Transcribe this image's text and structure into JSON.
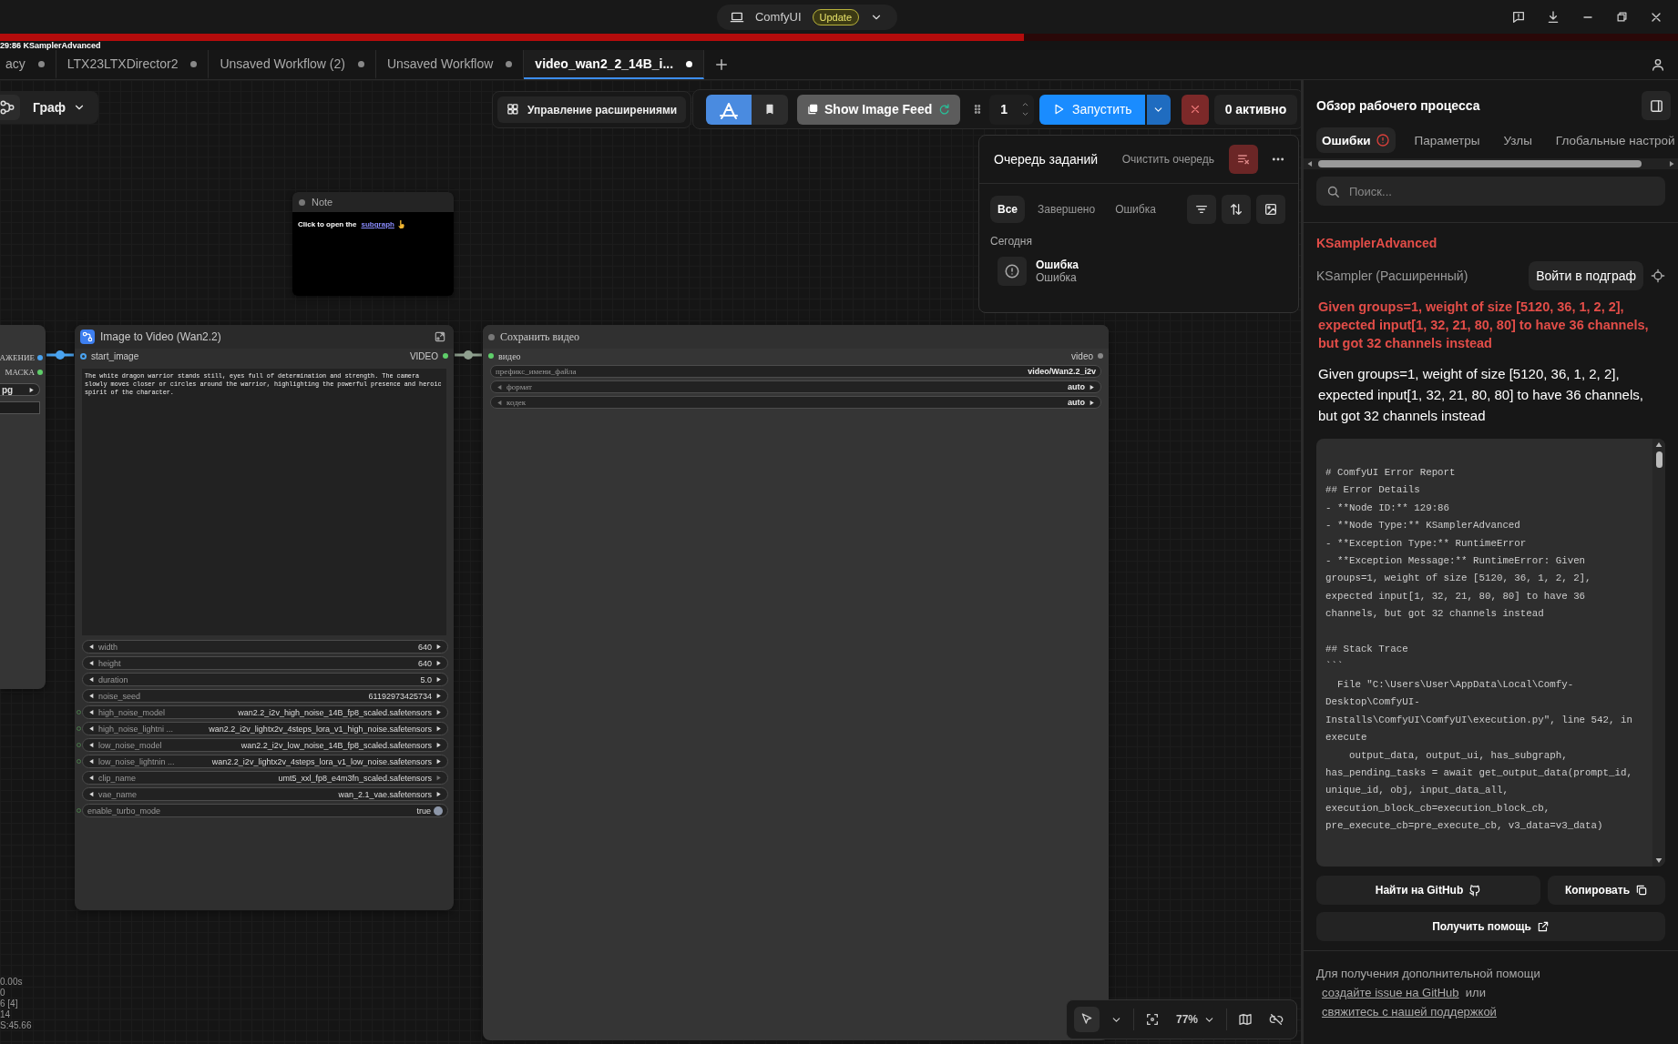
{
  "title_bar": {
    "app_name": "ComfyUI",
    "badge": "Update"
  },
  "progress": {
    "level": 0.61,
    "label": "29:86 KSamplerAdvanced"
  },
  "tabs": [
    {
      "label": "acy",
      "selected": false,
      "modified": true
    },
    {
      "label": "LTX23LTXDirector2",
      "selected": false,
      "modified": true
    },
    {
      "label": "Unsaved Workflow (2)",
      "selected": false,
      "modified": true
    },
    {
      "label": "Unsaved Workflow",
      "selected": false,
      "modified": true
    },
    {
      "label": "video_wan2_2_14B_i...",
      "selected": true,
      "modified": true
    }
  ],
  "canvas_toolbar": {
    "view_menu": "Граф",
    "extensions_button": "Управление расширениями",
    "image_feed_button": "Show Image Feed",
    "batch_count": "1",
    "run_button": "Запустить",
    "active_count": "0 активно"
  },
  "queue": {
    "title": "Очередь заданий",
    "clear_button": "Очистить очередь",
    "filters": [
      {
        "label": "Все",
        "selected": true
      },
      {
        "label": "Завершено",
        "selected": false
      },
      {
        "label": "Ошибка",
        "selected": false
      }
    ],
    "group": "Сегодня",
    "jobs": [
      {
        "title": "Ошибка",
        "status": "Ошибка"
      }
    ]
  },
  "note_node": {
    "title": "Note",
    "text": "Click to open the",
    "link": "subgraph"
  },
  "left_node": {
    "outputs": [
      {
        "label": "АЖЕНИЕ",
        "color": "#4aa3ef"
      },
      {
        "label": "МАСКА",
        "color": "#5fcf6a"
      }
    ],
    "combo_value": "pg"
  },
  "i2v_node": {
    "title": "Image to Video (Wan2.2)",
    "input": "start_image",
    "output": "VIDEO",
    "prompt": "The white dragon warrior stands still, eyes full of determination and strength. The camera slowly moves closer or circles around the warrior, highlighting the powerful presence and heroic spirit of the character.",
    "widgets": [
      {
        "kind": "number",
        "name": "width",
        "value": "640",
        "socket": false
      },
      {
        "kind": "number",
        "name": "height",
        "value": "640",
        "socket": false
      },
      {
        "kind": "number",
        "name": "duration",
        "value": "5.0",
        "socket": false
      },
      {
        "kind": "number",
        "name": "noise_seed",
        "value": "61192973425734",
        "socket": false
      },
      {
        "kind": "combo",
        "name": "high_noise_model",
        "value": "wan2.2_i2v_high_noise_14B_fp8_scaled.safetensors",
        "socket": true
      },
      {
        "kind": "combo",
        "name": "high_noise_lightni ...",
        "value": "wan2.2_i2v_lightx2v_4steps_lora_v1_high_noise.safetensors",
        "socket": true
      },
      {
        "kind": "combo",
        "name": "low_noise_model",
        "value": "wan2.2_i2v_low_noise_14B_fp8_scaled.safetensors",
        "socket": true
      },
      {
        "kind": "combo",
        "name": "low_noise_lightnin ...",
        "value": "wan2.2_i2v_lightx2v_4steps_lora_v1_low_noise.safetensors",
        "socket": true
      },
      {
        "kind": "combo",
        "name": "clip_name",
        "value": "umt5_xxl_fp8_e4m3fn_scaled.safetensors",
        "socket": false
      },
      {
        "kind": "combo",
        "name": "vae_name",
        "value": "wan_2.1_vae.safetensors",
        "socket": false
      },
      {
        "kind": "toggle",
        "name": "enable_turbo_mode",
        "value": "true",
        "socket": true
      }
    ]
  },
  "save_node": {
    "title": "Сохранить видео",
    "input": "видео",
    "output": "video",
    "widgets": [
      {
        "kind": "text",
        "name": "префикс_имени_файла",
        "value": "video/Wan2.2_i2v"
      },
      {
        "kind": "combo",
        "name": "формат",
        "value": "auto"
      },
      {
        "kind": "combo",
        "name": "кодек",
        "value": "auto"
      }
    ]
  },
  "stats": [
    "0.00s",
    "0",
    "6 [4]",
    "14",
    "S:45.66"
  ],
  "zoom_toolbar": {
    "zoom": "77%"
  },
  "panel": {
    "title": "Обзор рабочего процесса",
    "tabs": [
      {
        "label": "Ошибки",
        "selected": true,
        "alert": true
      },
      {
        "label": "Параметры",
        "selected": false,
        "alert": false
      },
      {
        "label": "Узлы",
        "selected": false,
        "alert": false
      },
      {
        "label": "Глобальные настрой",
        "selected": false,
        "alert": false
      }
    ],
    "search": {
      "placeholder": "Поиск..."
    },
    "error": {
      "node_type": "KSamplerAdvanced",
      "node_title": "KSampler (Расширенный)",
      "enter_button": "Войти в подграф",
      "message": "Given groups=1, weight of size [5120, 36, 1, 2, 2], expected input[1, 32, 21, 80, 80] to have 36 channels, but got 32 channels instead",
      "details": "Given groups=1, weight of size [5120, 36, 1, 2, 2], expected input[1, 32, 21, 80, 80] to have 36 channels, but got 32 channels instead",
      "report": "# ComfyUI Error Report\n## Error Details\n- **Node ID:** 129:86\n- **Node Type:** KSamplerAdvanced\n- **Exception Type:** RuntimeError\n- **Exception Message:** RuntimeError: Given\ngroups=1, weight of size [5120, 36, 1, 2, 2],\nexpected input[1, 32, 21, 80, 80] to have 36\nchannels, but got 32 channels instead\n\n## Stack Trace\n```\n  File \"C:\\Users\\User\\AppData\\Local\\Comfy-\nDesktop\\ComfyUI-\nInstalls\\ComfyUI\\ComfyUI\\execution.py\", line 542, in\nexecute\n    output_data, output_ui, has_subgraph,\nhas_pending_tasks = await get_output_data(prompt_id,\nunique_id, obj, input_data_all,\nexecution_block_cb=execution_block_cb,\npre_execute_cb=pre_execute_cb, v3_data=v3_data)",
      "github_button": "Найти на GitHub",
      "copy_button": "Копировать",
      "help_button": "Получить помощь"
    },
    "footer": {
      "text": "Для получения дополнительной помощи",
      "issue_link": "создайте issue на GitHub",
      "or": "или",
      "support_link": "свяжитесь с нашей поддержкой"
    }
  }
}
